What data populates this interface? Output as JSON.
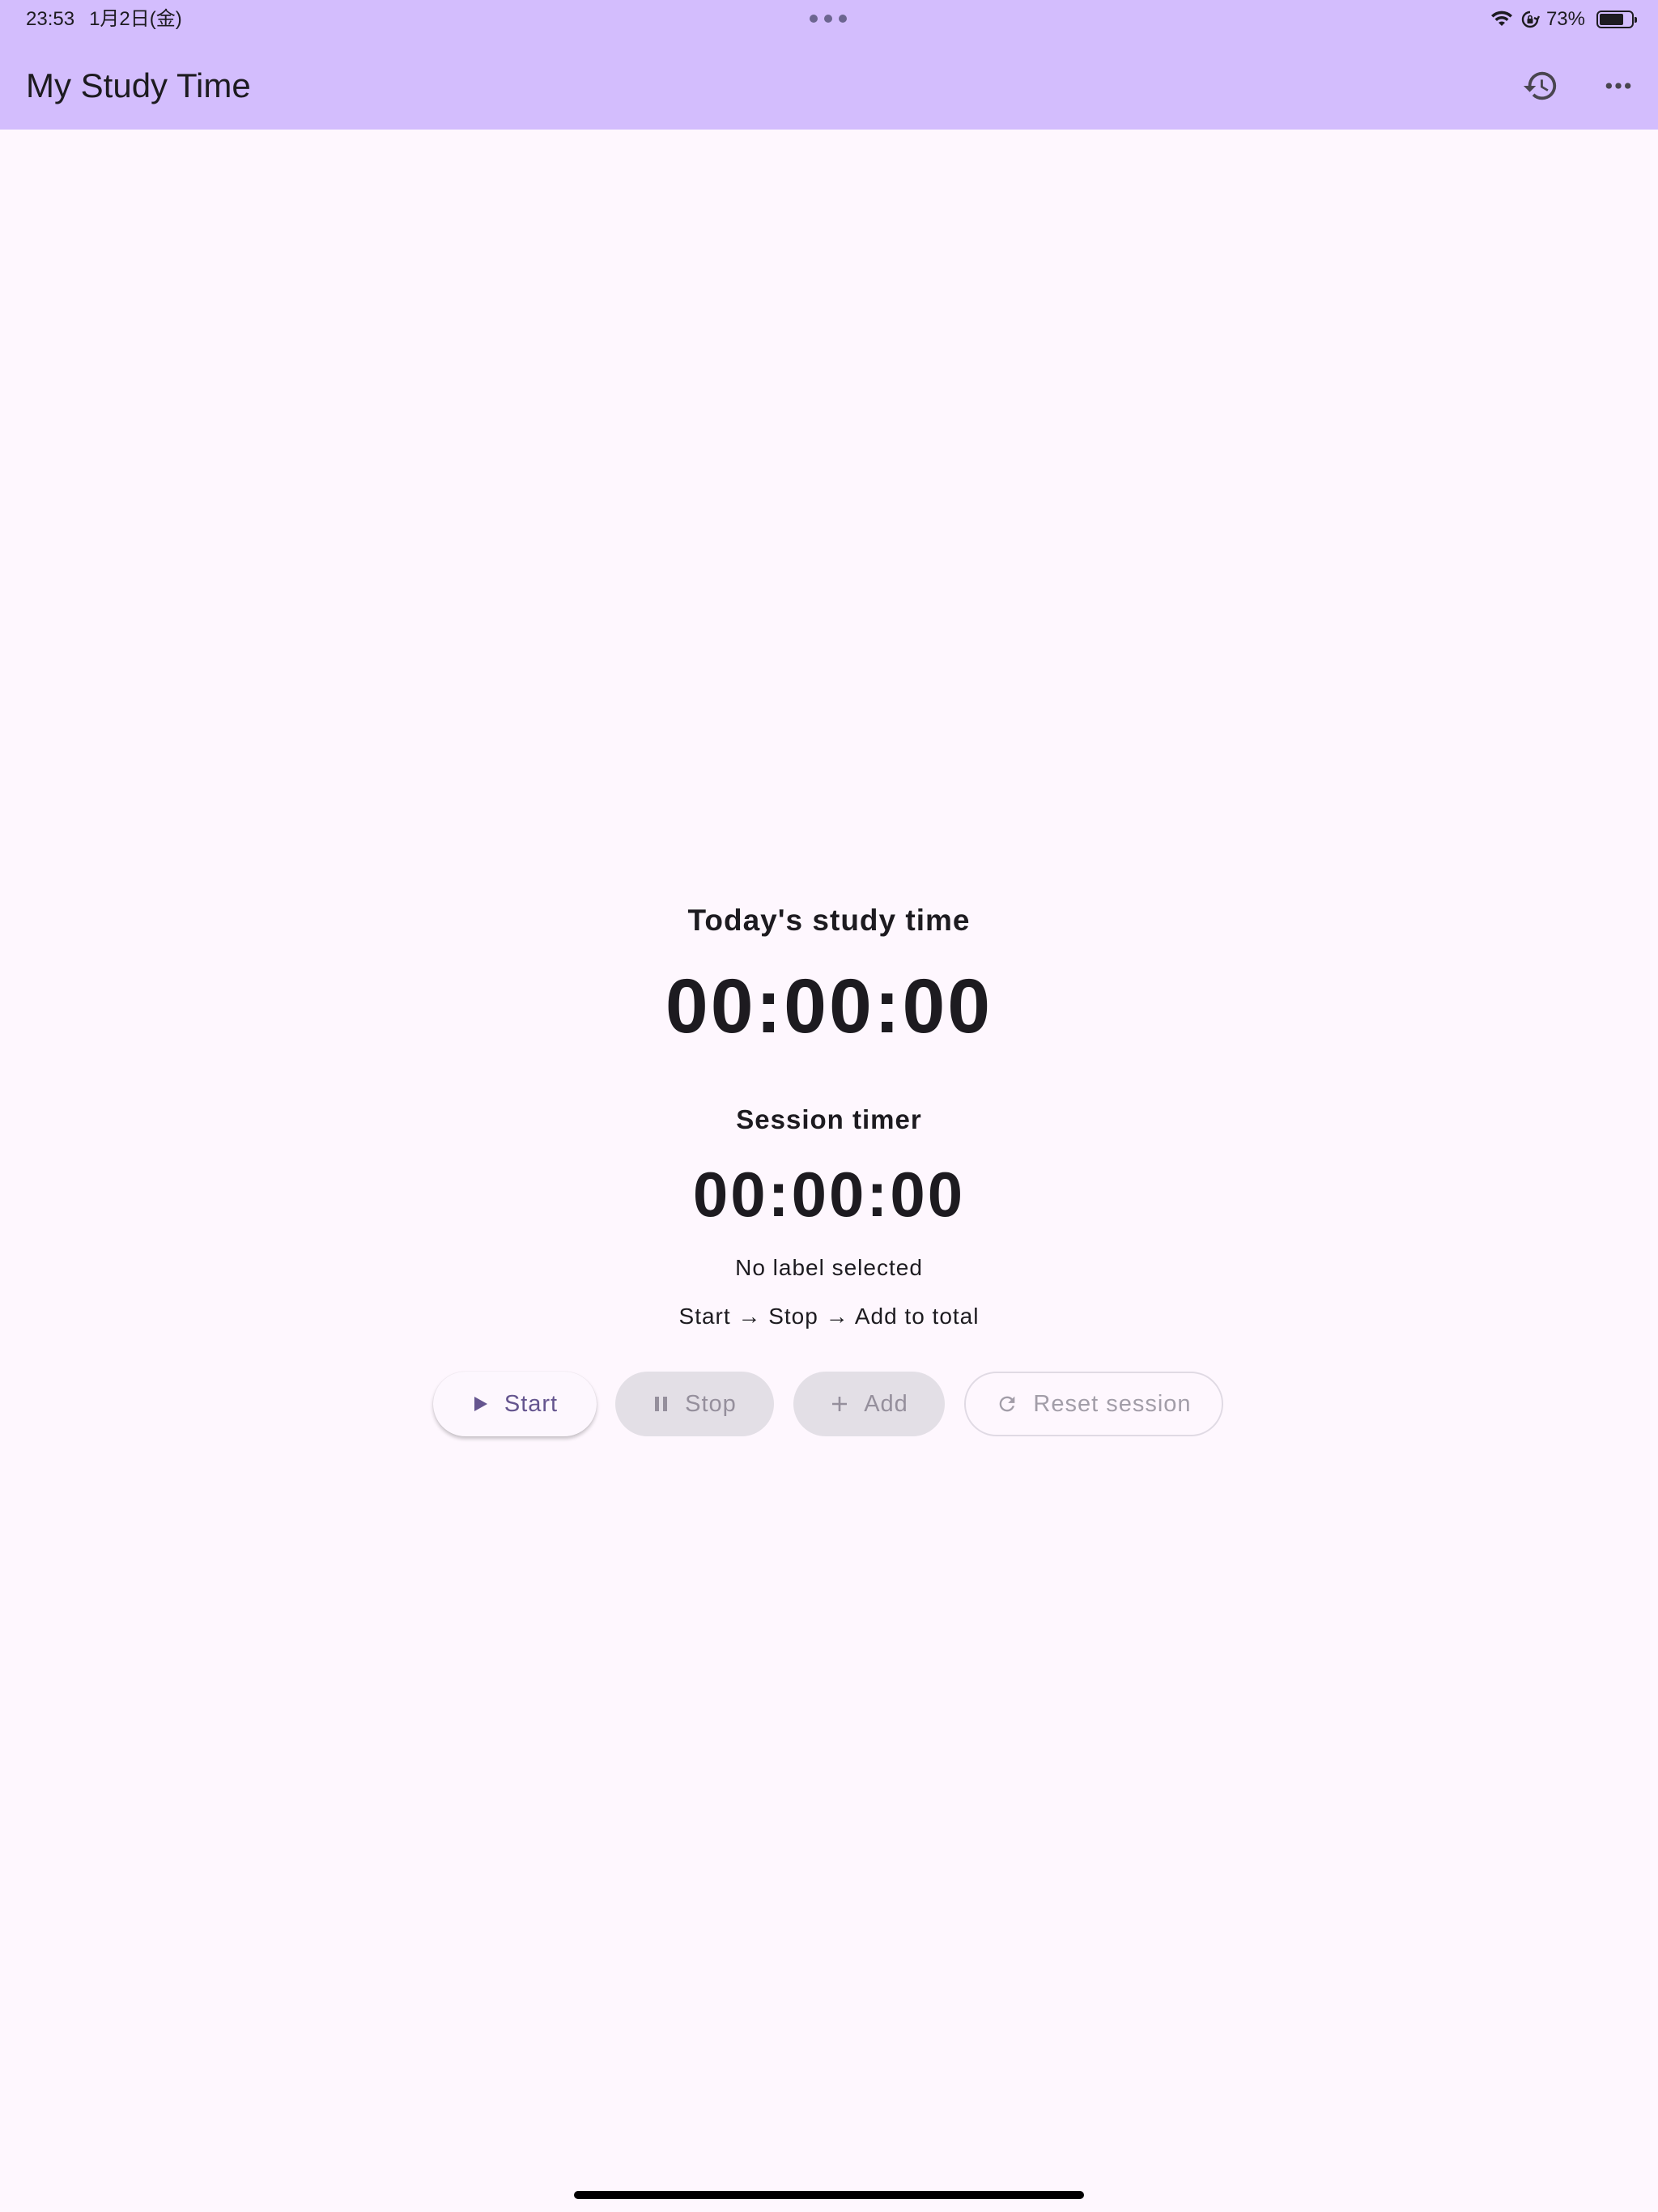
{
  "status_bar": {
    "time": "23:53",
    "date": "1月2日(金)",
    "battery": "73%"
  },
  "app_bar": {
    "title": "My Study Time",
    "actions": [
      "history-icon",
      "more-horiz-icon"
    ]
  },
  "today": {
    "label": "Today's study time",
    "value": "00:00:00"
  },
  "session": {
    "label": "Session timer",
    "value": "00:00:00",
    "label_status": "No label selected",
    "hint": "Start → Stop → Add to total"
  },
  "buttons": {
    "start": "Start",
    "stop": "Stop",
    "add": "Add",
    "reset": "Reset session"
  },
  "colors": {
    "app_bar": "#d3bdfd",
    "background": "#fef7fe",
    "primary": "#65558f",
    "disabled_bg": "#e3dfe6",
    "disabled_text": "#958f9c"
  }
}
